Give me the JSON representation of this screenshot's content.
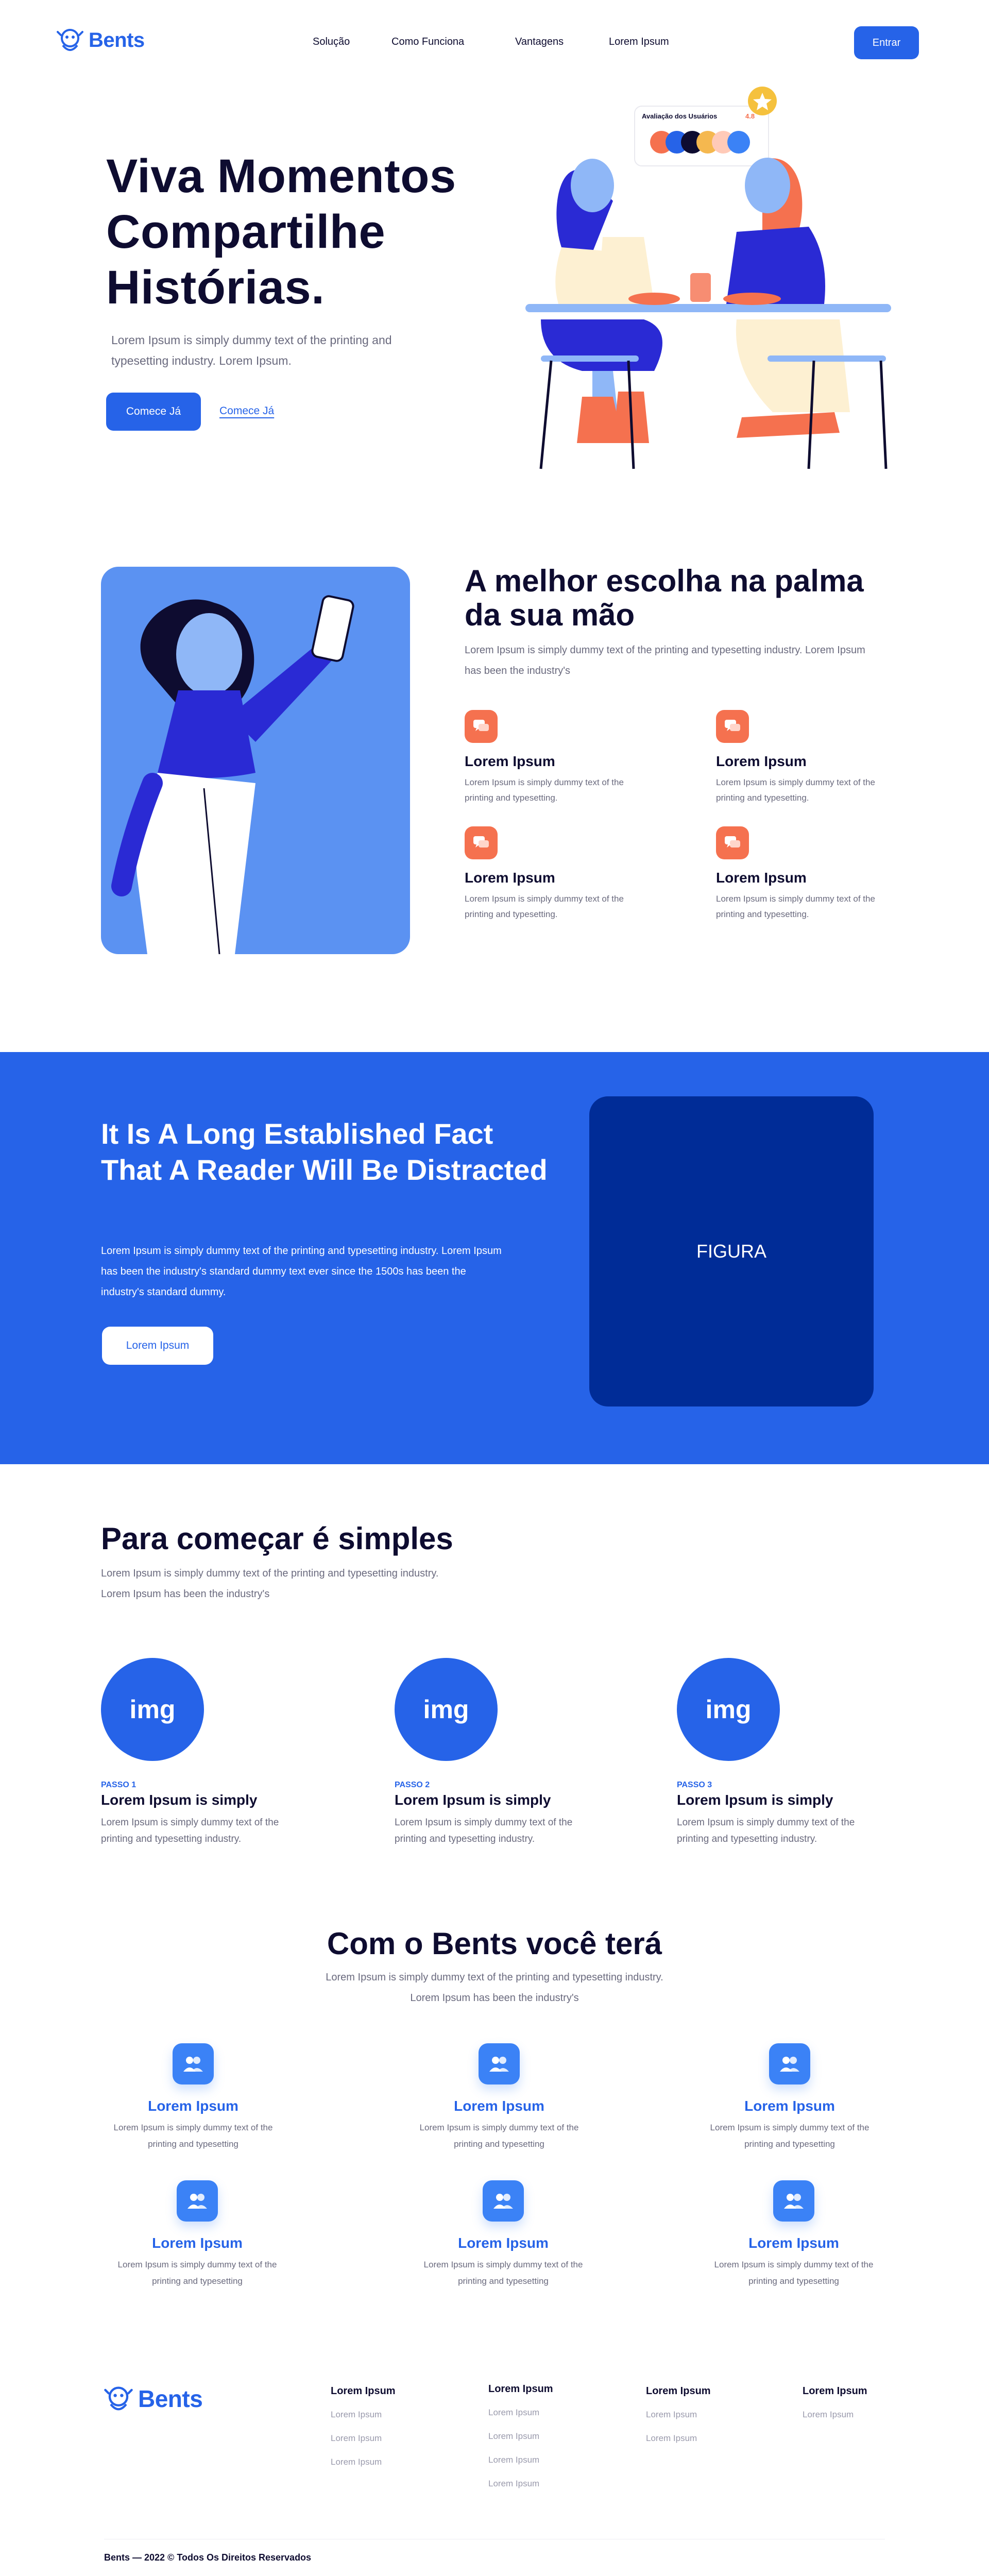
{
  "header": {
    "logo_text": "Bents",
    "nav": [
      "Solução",
      "Como Funciona",
      "Vantagens",
      "Lorem Ipsum"
    ],
    "login_label": "Entrar"
  },
  "hero": {
    "title_lines": [
      "Viva Momentos",
      "Compartilhe",
      "Histórias."
    ],
    "subtitle": "Lorem Ipsum is simply dummy text of the printing and typesetting industry. Lorem Ipsum.",
    "primary_cta": "Comece Já",
    "secondary_cta": "Comece Já",
    "rating_label": "Avaliação dos Usuários",
    "rating_value": "4.8"
  },
  "features": {
    "title": "A melhor escolha na palma da sua mão",
    "subtitle": "Lorem Ipsum is simply dummy text of the printing and typesetting industry. Lorem Ipsum has been the industry's",
    "items": [
      {
        "title": "Lorem Ipsum",
        "desc": "Lorem Ipsum is simply dummy text of the printing and typesetting."
      },
      {
        "title": "Lorem Ipsum",
        "desc": "Lorem Ipsum is simply dummy text of the printing and typesetting."
      },
      {
        "title": "Lorem Ipsum",
        "desc": "Lorem Ipsum is simply dummy text of the printing and typesetting."
      },
      {
        "title": "Lorem Ipsum",
        "desc": "Lorem Ipsum is simply dummy text of the printing and typesetting."
      }
    ]
  },
  "banner": {
    "title": "It Is A Long Established Fact That A Reader Will Be Distracted",
    "body": "Lorem Ipsum is simply dummy text of the printing and typesetting industry. Lorem Ipsum has been the industry's standard dummy text ever since the 1500s has been the industry's standard dummy.",
    "button": "Lorem Ipsum",
    "figure_label": "FIGURA"
  },
  "steps": {
    "title": "Para começar é simples",
    "subtitle": "Lorem Ipsum is simply dummy text of the printing and typesetting industry. Lorem Ipsum has been the industry's",
    "items": [
      {
        "img": "img",
        "tag": "PASSO 1",
        "title": "Lorem Ipsum is simply",
        "desc": "Lorem Ipsum is simply dummy text of the printing and typesetting industry."
      },
      {
        "img": "img",
        "tag": "PASSO 2",
        "title": "Lorem Ipsum is simply",
        "desc": "Lorem Ipsum is simply dummy text of the printing and typesetting industry."
      },
      {
        "img": "img",
        "tag": "PASSO 3",
        "title": "Lorem Ipsum is simply",
        "desc": "Lorem Ipsum is simply dummy text of the printing and typesetting industry."
      }
    ]
  },
  "benefits": {
    "title": "Com o Bents você terá",
    "subtitle": "Lorem Ipsum is simply dummy text of the printing and typesetting industry. Lorem Ipsum has been the industry's",
    "items": [
      {
        "title": "Lorem Ipsum",
        "desc": "Lorem Ipsum is simply dummy text of the printing and typesetting"
      },
      {
        "title": "Lorem Ipsum",
        "desc": "Lorem Ipsum is simply dummy text of the printing and typesetting"
      },
      {
        "title": "Lorem Ipsum",
        "desc": "Lorem Ipsum is simply dummy text of the printing and typesetting"
      },
      {
        "title": "Lorem Ipsum",
        "desc": "Lorem Ipsum is simply dummy text of the printing and typesetting"
      },
      {
        "title": "Lorem Ipsum",
        "desc": "Lorem Ipsum is simply dummy text of the printing and typesetting"
      },
      {
        "title": "Lorem Ipsum",
        "desc": "Lorem Ipsum is simply dummy text of the printing and typesetting"
      }
    ]
  },
  "footer": {
    "logo_text": "Bents",
    "columns": [
      {
        "head": "Lorem Ipsum",
        "links": [
          "Lorem Ipsum",
          "Lorem Ipsum",
          "Lorem Ipsum"
        ]
      },
      {
        "head": "Lorem Ipsum",
        "links": [
          "Lorem Ipsum",
          "Lorem Ipsum",
          "Lorem Ipsum",
          "Lorem Ipsum"
        ]
      },
      {
        "head": "Lorem Ipsum",
        "links": [
          "Lorem Ipsum",
          "Lorem Ipsum"
        ]
      },
      {
        "head": "Lorem Ipsum",
        "links": [
          "Lorem Ipsum"
        ]
      }
    ],
    "copyright": "Bents — 2022 © Todos Os Direitos Reservados"
  },
  "colors": {
    "primary": "#2663e8",
    "navy": "#0e0c30",
    "accent_coral": "#f5714f",
    "banner_bg": "#2663e8",
    "figure_bg": "#002c97"
  }
}
